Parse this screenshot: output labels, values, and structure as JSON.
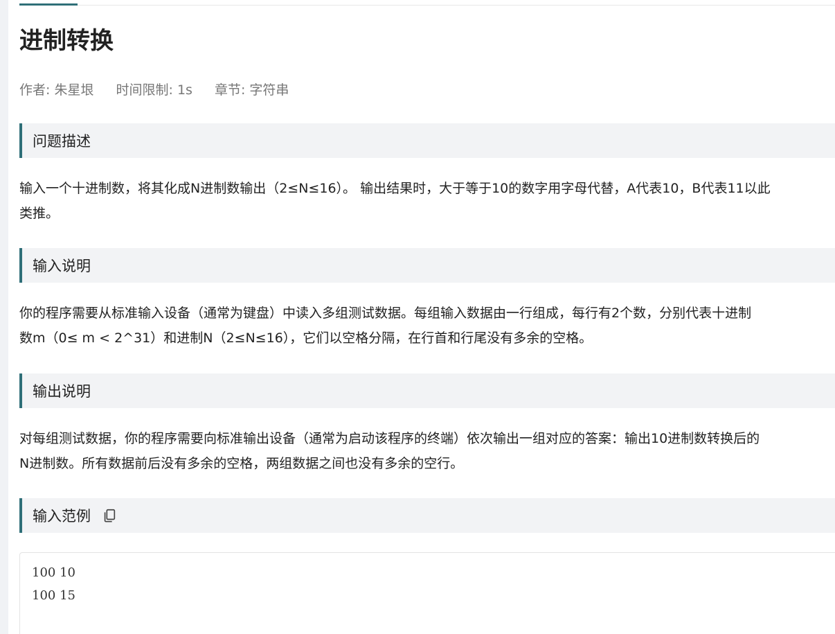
{
  "problem": {
    "title": "进制转换",
    "meta": {
      "author": "作者: 朱星垠",
      "time_limit": "时间限制: 1s",
      "chapter": "章节: 字符串"
    }
  },
  "sections": {
    "description": {
      "heading": "问题描述",
      "lines": [
        "输入一个十进制数，将其化成N进制数输出（2≤N≤16）。 输出结果时，大于等于10的数字用字母代替，A代表10，B代表11以此",
        "类推。"
      ]
    },
    "input": {
      "heading": "输入说明",
      "lines": [
        "你的程序需要从标准输入设备（通常为键盘）中读入多组测试数据。每组输入数据由一行组成，每行有2个数，分别代表十进制",
        "数m（0≤ m < 2^31）和进制N（2≤N≤16），它们以空格分隔，在行首和行尾没有多余的空格。"
      ]
    },
    "output": {
      "heading": "输出说明",
      "lines": [
        "对每组测试数据，你的程序需要向标准输出设备（通常为启动该程序的终端）依次输出一组对应的答案：输出10进制数转换后的",
        "N进制数。所有数据前后没有多余的空格，两组数据之间也没有多余的空行。"
      ]
    },
    "sample_input": {
      "heading": "输入范例",
      "copy_icon": "copy-icon",
      "lines": [
        "100 10",
        "100 15"
      ]
    }
  },
  "colors": {
    "accent": "#2f6f78",
    "heading_bg": "#f2f3f5",
    "meta_text": "#777777"
  }
}
